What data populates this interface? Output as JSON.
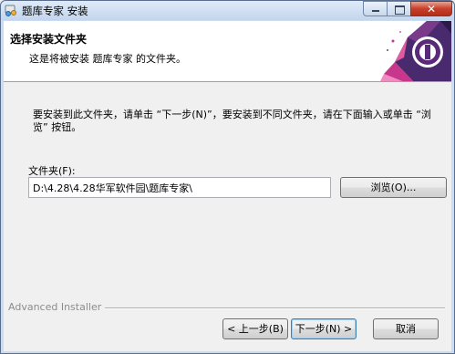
{
  "window": {
    "title": "题库专家 安装"
  },
  "banner": {
    "title": "选择安装文件夹",
    "subtitle": "这是将被安装 题库专家 的文件夹。"
  },
  "body": {
    "description": "要安装到此文件夹，请单击 “下一步(N)”，要安装到不同文件夹，请在下面输入或单击 “浏览” 按钮。",
    "folder_label": "文件夹(F):",
    "folder_value": "D:\\4.28\\4.28华军软件园\\题库专家\\",
    "browse_label": "浏览(O)..."
  },
  "footer": {
    "brand": "Advanced Installer",
    "back_label": "< 上一步(B)",
    "next_label": "下一步(N) >",
    "cancel_label": "取消"
  },
  "icons": {
    "app": "installer-app-icon",
    "logo": "advanced-installer-logo",
    "minimize": "minimize-icon",
    "maximize": "maximize-icon",
    "close": "close-icon"
  },
  "colors": {
    "titlebar": "#c9dcf2",
    "close_button": "#c7402b",
    "logo_purple": "#5a2a7a",
    "logo_pink": "#d0357a"
  }
}
